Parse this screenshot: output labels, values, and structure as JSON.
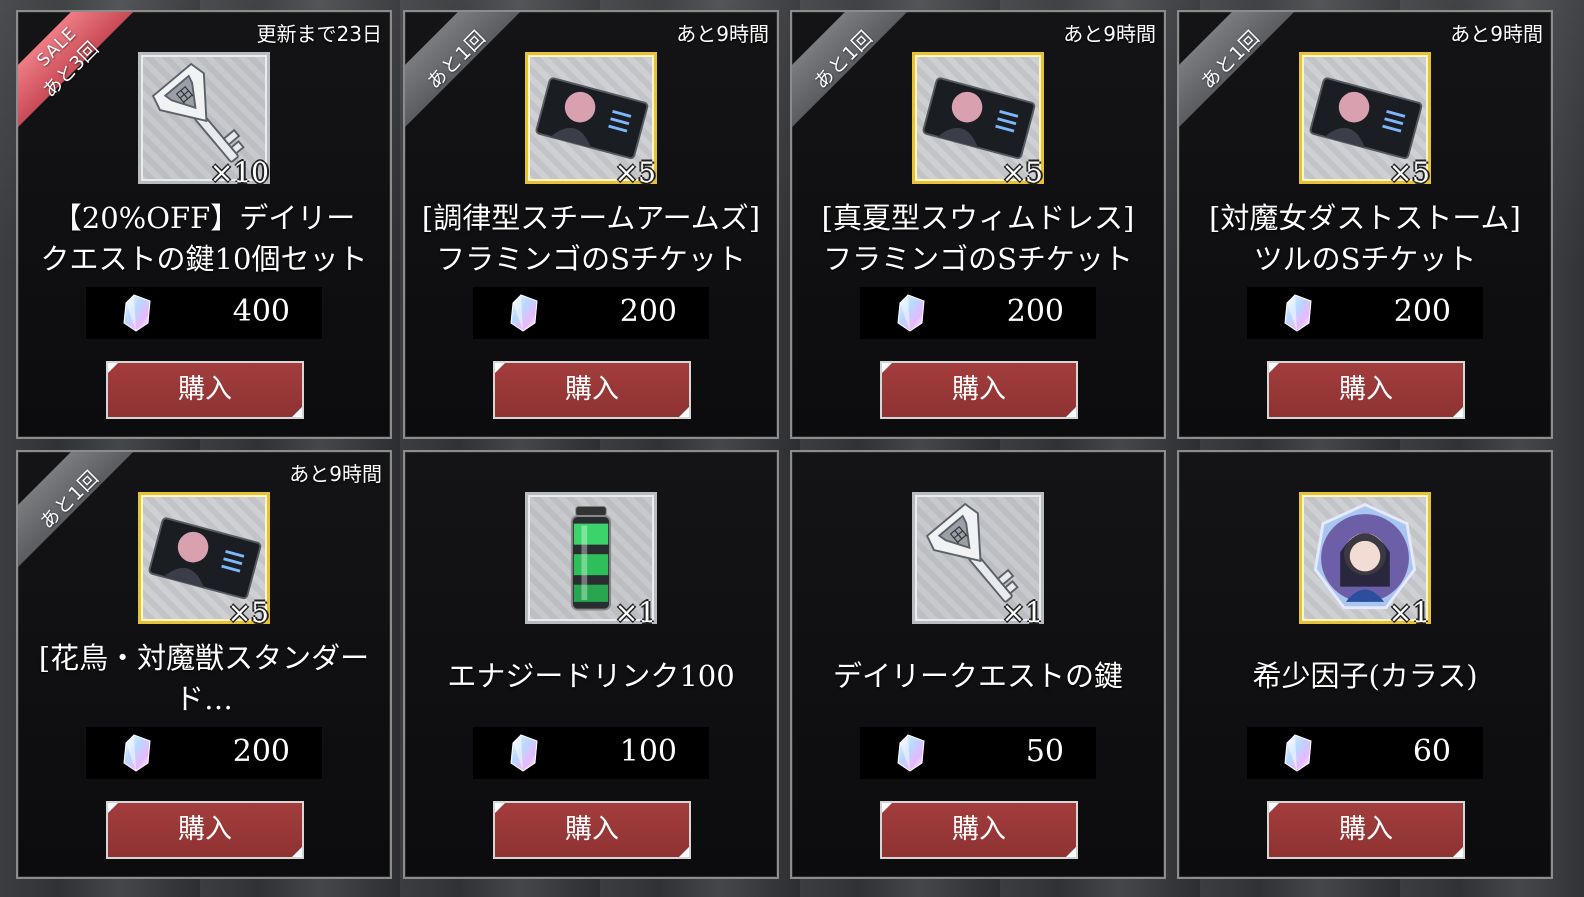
{
  "colors": {
    "buy_button": "#9a3838",
    "sale_ribbon": "#e06a74",
    "gold_frame": "#e6c13a",
    "silver_frame": "#b8bcc2"
  },
  "items": [
    {
      "ribbon": "SALE",
      "limit": "あと3回",
      "timer": "更新まで23日",
      "frame": "silver",
      "icon": "key-icon",
      "qty": "×10",
      "name": "【20%OFF】デイリー\nクエストの鍵10個セット",
      "price": "400",
      "buy": "購入"
    },
    {
      "ribbon": "",
      "limit": "あと1回",
      "timer": "あと9時間",
      "frame": "gold",
      "icon": "ticket-icon",
      "qty": "×5",
      "name": "[調律型スチームアームズ]\nフラミンゴのSチケット",
      "price": "200",
      "buy": "購入"
    },
    {
      "ribbon": "",
      "limit": "あと1回",
      "timer": "あと9時間",
      "frame": "gold",
      "icon": "ticket-icon",
      "qty": "×5",
      "name": "[真夏型スウィムドレス]\nフラミンゴのSチケット",
      "price": "200",
      "buy": "購入"
    },
    {
      "ribbon": "",
      "limit": "あと1回",
      "timer": "あと9時間",
      "frame": "gold",
      "icon": "ticket-icon",
      "qty": "×5",
      "name": "[対魔女ダストストーム]\nツルのSチケット",
      "price": "200",
      "buy": "購入"
    },
    {
      "ribbon": "",
      "limit": "あと1回",
      "timer": "あと9時間",
      "frame": "gold",
      "icon": "ticket-icon",
      "qty": "×5",
      "name": "[花鳥・対魔獣スタンダー\nド…",
      "price": "200",
      "buy": "購入"
    },
    {
      "ribbon": "",
      "limit": "",
      "timer": "",
      "frame": "silver",
      "icon": "energy-drink-icon",
      "qty": "×1",
      "name": "エナジードリンク100",
      "price": "100",
      "buy": "購入"
    },
    {
      "ribbon": "",
      "limit": "",
      "timer": "",
      "frame": "silver",
      "icon": "key-icon",
      "qty": "×1",
      "name": "デイリークエストの鍵",
      "price": "50",
      "buy": "購入"
    },
    {
      "ribbon": "",
      "limit": "",
      "timer": "",
      "frame": "gold",
      "icon": "rare-factor-icon",
      "qty": "×1",
      "name": "希少因子(カラス)",
      "price": "60",
      "buy": "購入"
    }
  ]
}
